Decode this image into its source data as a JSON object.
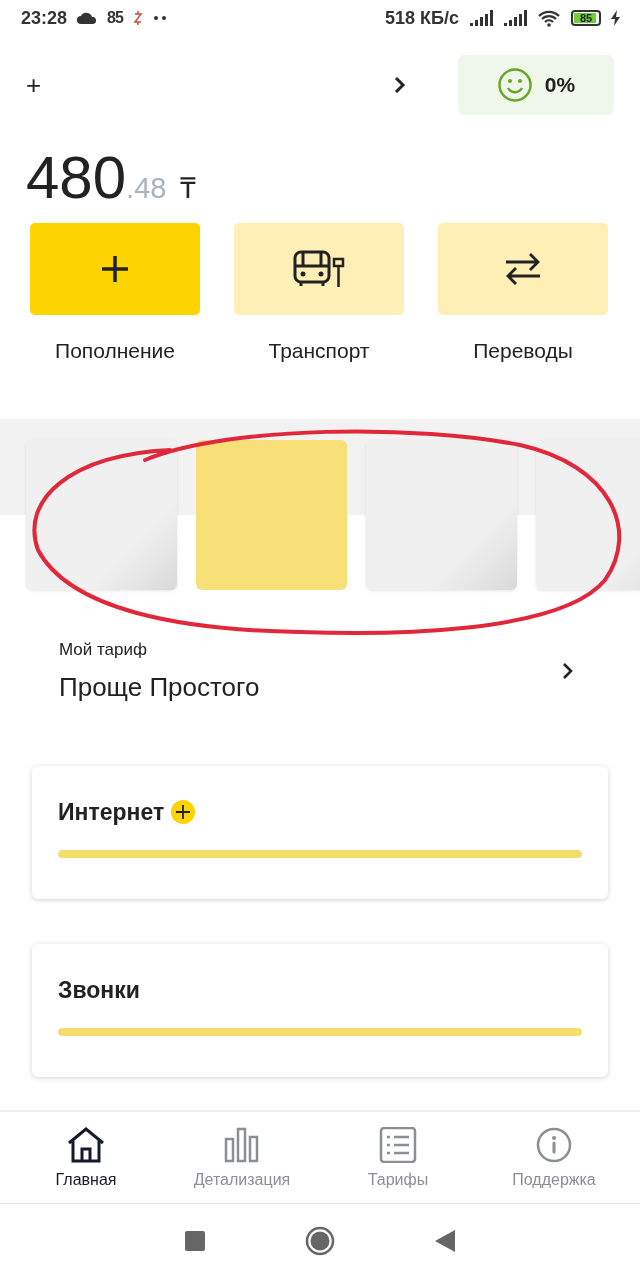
{
  "status_bar": {
    "time": "23:28",
    "notification": "85",
    "speed": "518 КБ/с",
    "battery": "85"
  },
  "account": {
    "phone": "+",
    "rating": "0%"
  },
  "balance": {
    "whole": "480",
    "fraction": ".48",
    "currency": "₸"
  },
  "actions": [
    {
      "kind": "topup",
      "label": "Пополнение",
      "primary": true
    },
    {
      "kind": "transport",
      "label": "Транспорт",
      "primary": false
    },
    {
      "kind": "transfers",
      "label": "Переводы",
      "primary": false
    }
  ],
  "banners": [
    {
      "highlighted": false
    },
    {
      "highlighted": true
    },
    {
      "highlighted": false
    },
    {
      "highlighted": false
    }
  ],
  "tariff": {
    "label": "Мой тариф",
    "name": "Проще Простого"
  },
  "usage": [
    {
      "title": "Интернет",
      "addable": true,
      "level": 1
    },
    {
      "title": "Звонки",
      "addable": false,
      "level": 1
    }
  ],
  "bottom_nav": [
    {
      "kind": "home",
      "label": "Главная",
      "selected": true
    },
    {
      "kind": "details",
      "label": "Детализация",
      "selected": false
    },
    {
      "kind": "tariffs",
      "label": "Тарифы",
      "selected": false
    },
    {
      "kind": "support",
      "label": "Поддержка",
      "selected": false
    }
  ],
  "annotation": {
    "circled": true
  }
}
